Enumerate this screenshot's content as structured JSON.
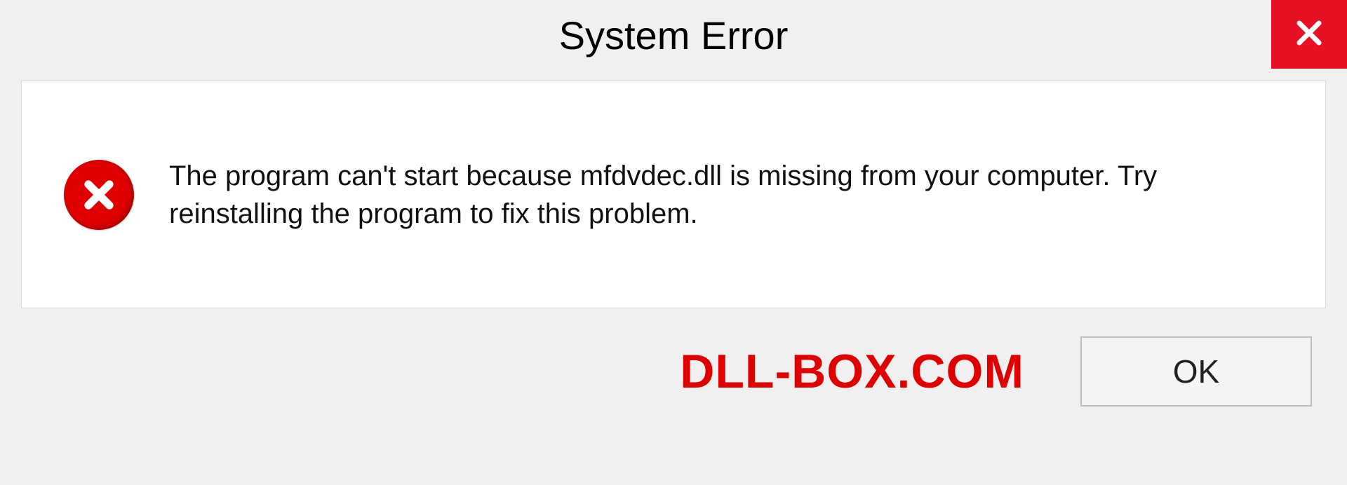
{
  "dialog": {
    "title": "System Error",
    "message": "The program can't start because mfdvdec.dll is missing from your computer. Try reinstalling the program to fix this problem.",
    "ok_label": "OK"
  },
  "watermark": "DLL-BOX.COM",
  "icons": {
    "close": "close-icon",
    "error": "error-circle-icon"
  },
  "colors": {
    "accent_red": "#e81123",
    "error_red": "#e00000"
  }
}
